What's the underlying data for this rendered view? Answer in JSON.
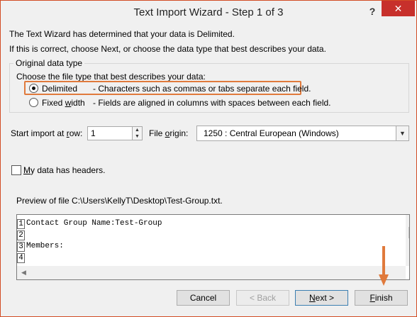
{
  "window": {
    "title": "Text Import Wizard - Step 1 of 3",
    "help": "?",
    "close": "✕"
  },
  "intro": {
    "line1": "The Text Wizard has determined that your data is Delimited.",
    "line2": "If this is correct, choose Next, or choose the data type that best describes your data."
  },
  "original": {
    "group_title": "Original data type",
    "prompt": "Choose the file type that best describes your data:",
    "delimited": {
      "label": "Delimited",
      "desc": "- Characters such as commas or tabs separate each field.",
      "selected": true
    },
    "fixed": {
      "label_pre": "Fixed ",
      "label_u": "w",
      "label_post": "idth",
      "desc": "- Fields are aligned in columns with spaces between each field.",
      "selected": false
    }
  },
  "start_row": {
    "label_pre": "Start import at ",
    "label_u": "r",
    "label_post": "ow:",
    "value": "1"
  },
  "file_origin": {
    "label_pre": "File ",
    "label_u": "o",
    "label_post": "rigin:",
    "value": "1250 : Central European (Windows)"
  },
  "headers": {
    "label_u": "M",
    "label_post": "y data has headers.",
    "checked": false
  },
  "preview": {
    "label": "Preview of file C:\\Users\\KellyT\\Desktop\\Test-Group.txt.",
    "rows": [
      {
        "n": "1",
        "text": "Contact Group Name:Test-Group"
      },
      {
        "n": "2",
        "text": ""
      },
      {
        "n": "3",
        "text": "Members:"
      },
      {
        "n": "4",
        "text": ""
      }
    ]
  },
  "buttons": {
    "cancel": "Cancel",
    "back": "< Back",
    "next_u": "N",
    "next_post": "ext >",
    "finish_u": "F",
    "finish_post": "inish"
  },
  "colors": {
    "accent": "#e07a3c",
    "close_bg": "#c7302b"
  }
}
